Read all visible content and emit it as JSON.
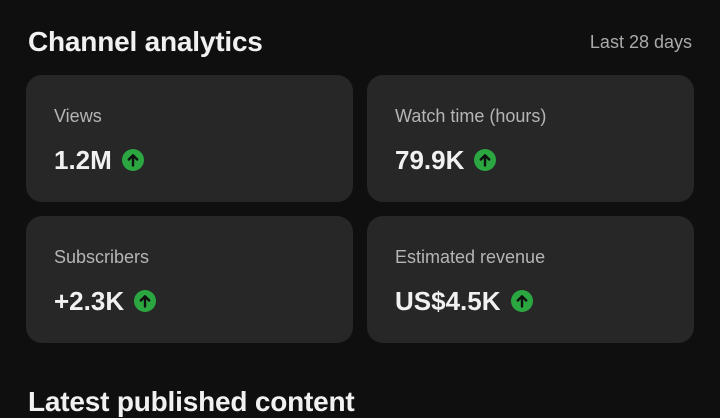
{
  "header": {
    "title": "Channel analytics",
    "range": "Last 28 days"
  },
  "metrics": [
    {
      "label": "Views",
      "value": "1.2M",
      "trend_icon": "arrow-up-circle-icon"
    },
    {
      "label": "Watch time (hours)",
      "value": "79.9K",
      "trend_icon": "arrow-up-circle-icon"
    },
    {
      "label": "Subscribers",
      "value": "+2.3K",
      "trend_icon": "arrow-up-circle-icon"
    },
    {
      "label": "Estimated revenue",
      "value": "US$4.5K",
      "trend_icon": "arrow-up-circle-icon"
    }
  ],
  "colors": {
    "background": "#0f0f0f",
    "card": "#272727",
    "trend_up": "#2ba640"
  },
  "latest": {
    "title": "Latest published content"
  }
}
